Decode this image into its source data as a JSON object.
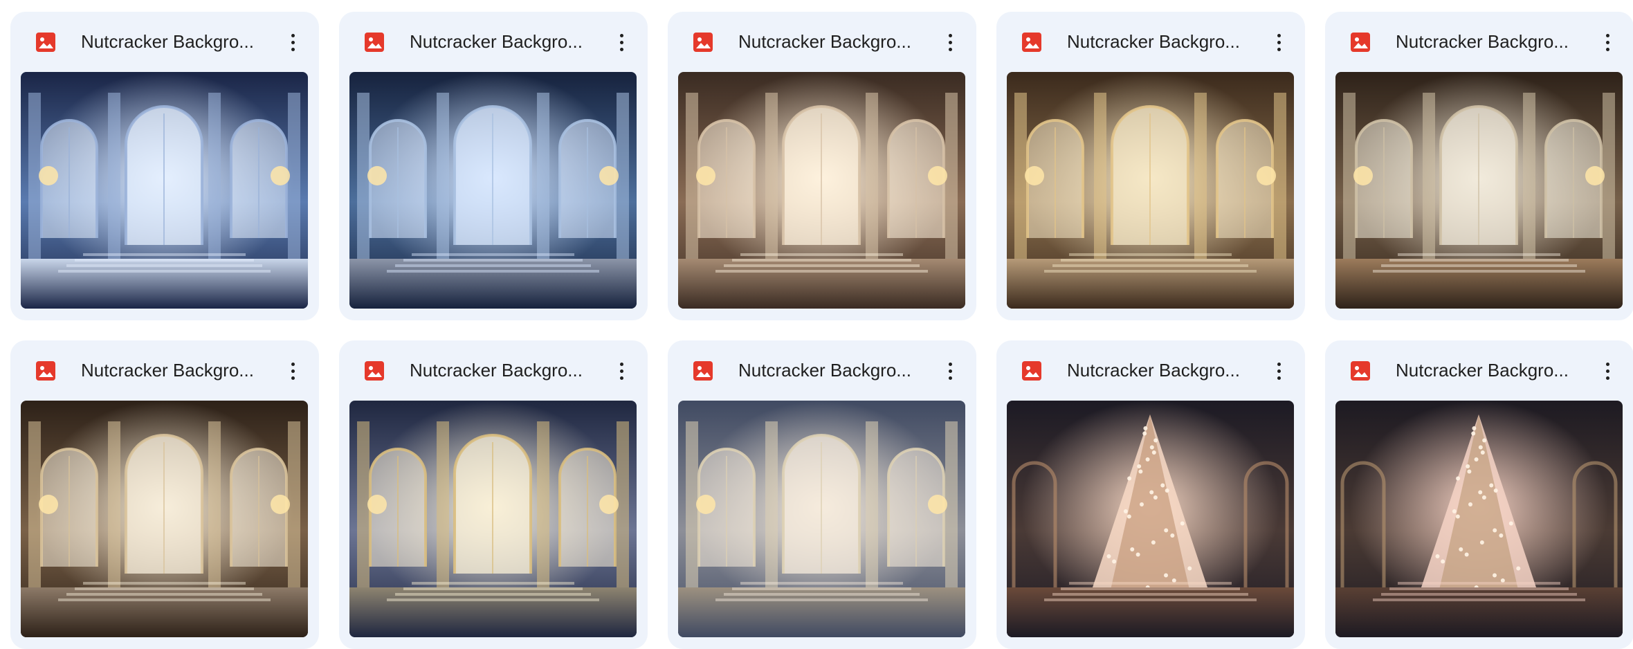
{
  "files": [
    {
      "name": "Nutcracker Backgro...",
      "icon": "image-file-icon",
      "palette": {
        "top": "#1a2546",
        "mid": "#5a7bb0",
        "glow": "#e6f0ff",
        "floor": "#c9d6ea",
        "arch": "#9bb3d9"
      }
    },
    {
      "name": "Nutcracker Backgro...",
      "icon": "image-file-icon",
      "palette": {
        "top": "#16223d",
        "mid": "#4d6f9c",
        "glow": "#dbe9ff",
        "floor": "#8c95a8",
        "arch": "#a8c0e0"
      }
    },
    {
      "name": "Nutcracker Backgro...",
      "icon": "image-file-icon",
      "palette": {
        "top": "#3a2b22",
        "mid": "#8a6c55",
        "glow": "#fff3df",
        "floor": "#a58a72",
        "arch": "#d7c2a7"
      }
    },
    {
      "name": "Nutcracker Backgro...",
      "icon": "image-file-icon",
      "palette": {
        "top": "#3b2a1c",
        "mid": "#8b6f4e",
        "glow": "#f7e9c8",
        "floor": "#b69a78",
        "arch": "#e2c48a"
      }
    },
    {
      "name": "Nutcracker Backgro...",
      "icon": "image-file-icon",
      "palette": {
        "top": "#2e2219",
        "mid": "#76604a",
        "glow": "#f3ecdd",
        "floor": "#9c7b5b",
        "arch": "#cfc1a6"
      }
    },
    {
      "name": "Nutcracker Backgro...",
      "icon": "image-file-icon",
      "palette": {
        "top": "#2d2118",
        "mid": "#7a6148",
        "glow": "#f8efdc",
        "floor": "#8d7a68",
        "arch": "#d9c39b"
      }
    },
    {
      "name": "Nutcracker Backgro...",
      "icon": "image-file-icon",
      "palette": {
        "top": "#1f2740",
        "mid": "#6c7594",
        "glow": "#fbf1d8",
        "floor": "#8e8470",
        "arch": "#d9be80"
      }
    },
    {
      "name": "Nutcracker Backgro...",
      "icon": "image-file-icon",
      "palette": {
        "top": "#404a62",
        "mid": "#8d8f98",
        "glow": "#f7ecdd",
        "floor": "#9d9180",
        "arch": "#ddd0b4"
      }
    },
    {
      "name": "Nutcracker Backgro...",
      "icon": "image-file-icon",
      "palette": {
        "top": "#1c1a24",
        "mid": "#4a3a36",
        "glow": "#f8d9c6",
        "floor": "#6b4a3a",
        "arch": "#b98d6a"
      }
    },
    {
      "name": "Nutcracker Backgro...",
      "icon": "image-file-icon",
      "palette": {
        "top": "#1d1a22",
        "mid": "#4b3b34",
        "glow": "#f6d3c5",
        "floor": "#5a4034",
        "arch": "#b6946e"
      }
    }
  ],
  "colors": {
    "card_bg": "#eef3fb",
    "icon_red": "#e5392b",
    "text": "#1f1f1f"
  }
}
